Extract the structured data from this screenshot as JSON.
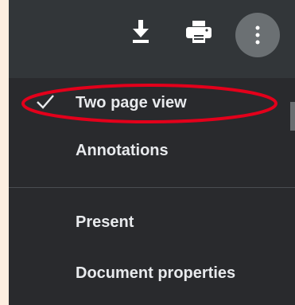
{
  "toolbar": {
    "download_icon": "download-icon",
    "print_icon": "print-icon",
    "more_icon": "more-vertical-icon"
  },
  "menu": {
    "items": [
      {
        "label": "Two page view",
        "checked": true
      },
      {
        "label": "Annotations",
        "checked": false
      },
      {
        "label": "Present",
        "checked": false
      },
      {
        "label": "Document properties",
        "checked": false
      }
    ]
  },
  "colors": {
    "toolbar_bg": "#323639",
    "menu_bg": "#292a2d",
    "text": "#e8eaed",
    "highlight": "#e3001b",
    "outer_bg": "#fdeee0"
  }
}
